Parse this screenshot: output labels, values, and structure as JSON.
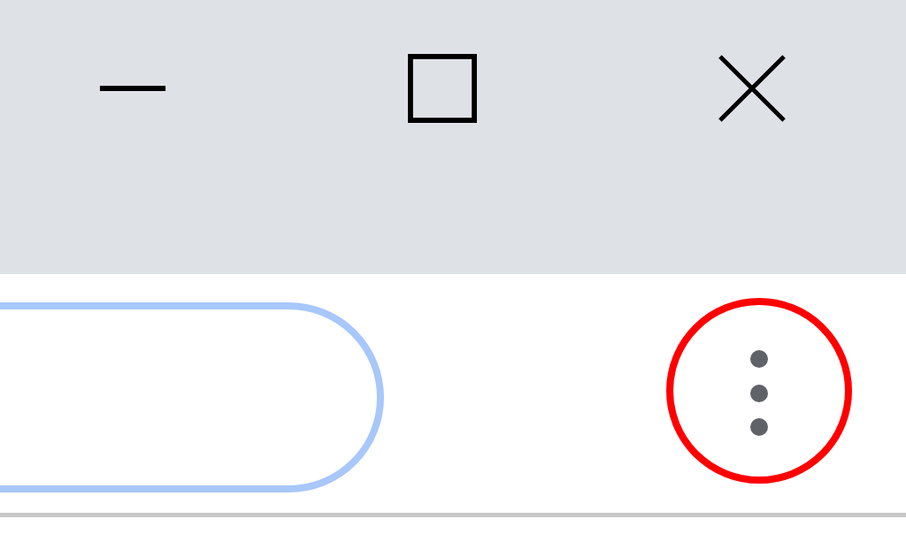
{
  "window_controls": [
    {
      "kind": "minimize"
    },
    {
      "kind": "maximize"
    },
    {
      "kind": "close"
    }
  ],
  "toolbar": {
    "address_bar": {
      "focused": true
    },
    "menu_button": {
      "highlighted": true
    }
  }
}
